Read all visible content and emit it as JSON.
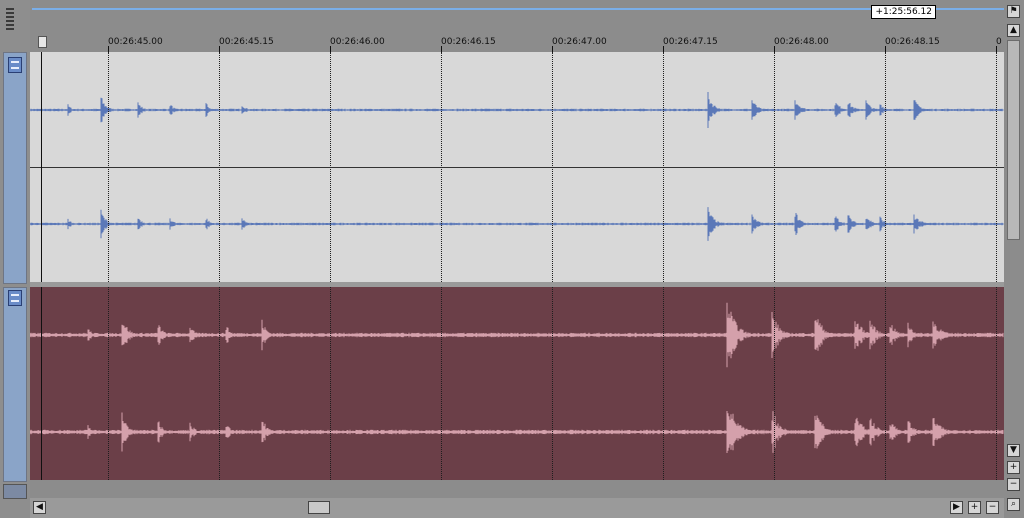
{
  "time_readout": "+1:25:56.12",
  "ruler_labels": [
    "00:26:45.00",
    "00:26:45.15",
    "00:26:46.00",
    "00:26:46.15",
    "00:26:47.00",
    "00:26:47.15",
    "00:26:48.00",
    "00:26:48.15",
    "0"
  ],
  "tracks": [
    {
      "name": "audio-track-1",
      "color": "#5b78b8",
      "background": "#d8d8d8"
    },
    {
      "name": "audio-track-2",
      "color": "#d4a0ab",
      "background": "#6b3f48"
    }
  ],
  "icons": {
    "flag": "flag-icon",
    "left_arrow": "arrow-left-icon",
    "right_arrow": "arrow-right-icon",
    "zoom_in": "zoom-in-icon",
    "zoom_out": "zoom-out-icon",
    "magnify": "magnify-icon",
    "grip": "grip-icon"
  },
  "controls": {
    "left_arrow": "◀",
    "right_arrow": "▶",
    "zoom_in": "+",
    "zoom_out": "−",
    "up_arrow": "▲",
    "down_arrow": "▼",
    "magnify": "⌕",
    "flag": "⚑"
  }
}
